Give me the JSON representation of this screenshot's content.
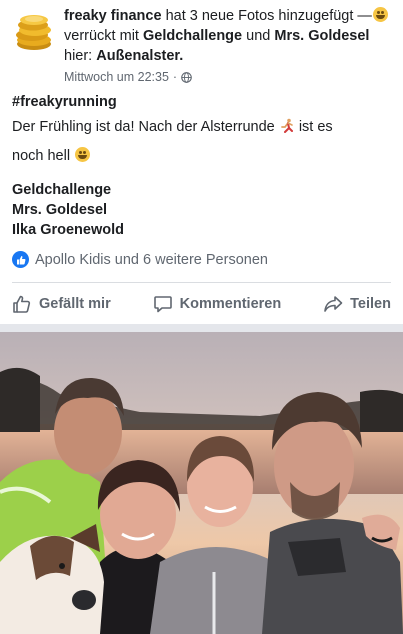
{
  "post": {
    "author": "freaky finance",
    "action_text": "hat 3 neue Fotos hinzugefügt —",
    "feeling": "verrückt",
    "with_text": "mit",
    "tag1": "Geldchallenge",
    "and_text": "und",
    "tag2": "Mrs. Goldesel",
    "location_prefix": "hier:",
    "location": "Außenalster.",
    "timestamp": "Mittwoch um 22:35",
    "dot": "·",
    "hashtag": "#freakyrunning",
    "text_line1": "Der Frühling ist da! Nach der Alsterrunde",
    "text_line1_end": "ist es",
    "text_line2": "noch hell",
    "names": [
      "Geldchallenge",
      "Mrs. Goldesel",
      "Ilka Groenewold"
    ],
    "reactions_text": "Apollo Kidis und 6 weitere Personen"
  },
  "actions": {
    "like": "Gefällt mir",
    "comment": "Kommentieren",
    "share": "Teilen"
  },
  "colors": {
    "brand_blue": "#1877f2",
    "secondary_text": "#606770"
  }
}
